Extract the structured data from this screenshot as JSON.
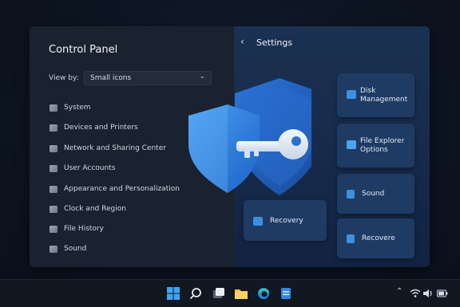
{
  "control_panel": {
    "title": "Control Panel",
    "view_by_label": "View by:",
    "view_by_value": "Small icons",
    "items": [
      {
        "label": "System",
        "icon": "system-icon"
      },
      {
        "label": "Devices and Printers",
        "icon": "printer-icon"
      },
      {
        "label": "Network and Sharing Center",
        "icon": "network-icon"
      },
      {
        "label": "User Accounts",
        "icon": "users-icon"
      },
      {
        "label": "Appearance and Personalization",
        "icon": "appearance-icon"
      },
      {
        "label": "Clock and Region",
        "icon": "clock-icon"
      },
      {
        "label": "File History",
        "icon": "file-history-icon"
      },
      {
        "label": "Sound",
        "icon": "sound-icon"
      }
    ]
  },
  "settings": {
    "title": "Settings",
    "cards": {
      "disk": "Disk\nManagement",
      "file_explorer": "File Explorer\nOptions",
      "sound": "Sound",
      "recovery": "Recovery",
      "recovere": "Recovere"
    }
  },
  "colors": {
    "accent": "#3d8fe0",
    "shield_front": "#2f86e6",
    "shield_back": "#1f5fb8"
  }
}
